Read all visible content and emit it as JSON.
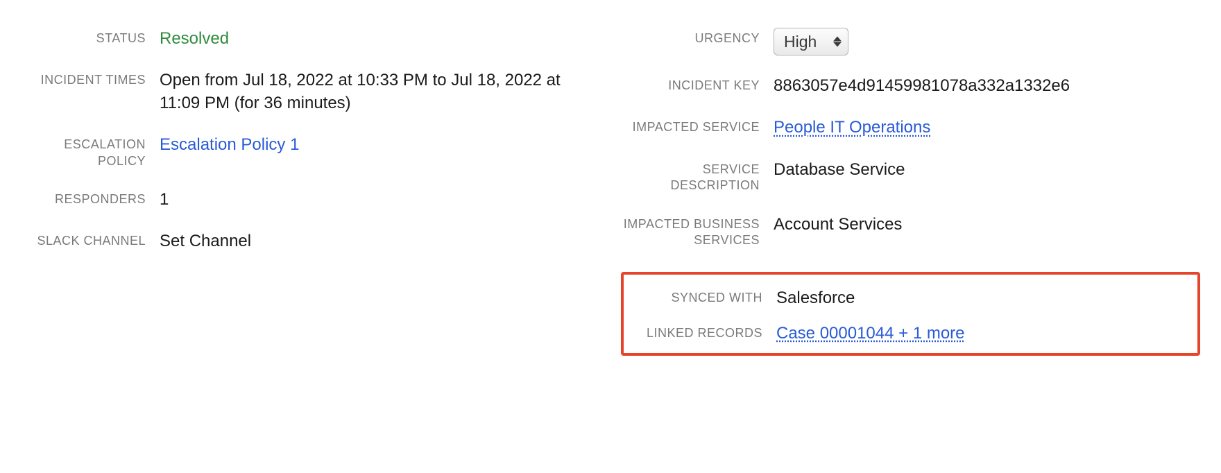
{
  "left": {
    "status": {
      "label": "STATUS",
      "value": "Resolved"
    },
    "incident_times": {
      "label": "INCIDENT TIMES",
      "value": "Open from Jul 18, 2022 at 10:33 PM to Jul 18, 2022 at 11:09 PM (for 36 minutes)"
    },
    "escalation_policy": {
      "label": "ESCALATION POLICY",
      "value": "Escalation Policy 1"
    },
    "responders": {
      "label": "RESPONDERS",
      "value": "1"
    },
    "slack_channel": {
      "label": "SLACK CHANNEL",
      "value": "Set Channel"
    }
  },
  "right": {
    "urgency": {
      "label": "URGENCY",
      "value": "High"
    },
    "incident_key": {
      "label": "INCIDENT KEY",
      "value": "8863057e4d91459981078a332a1332e6"
    },
    "impacted_service": {
      "label": "IMPACTED SERVICE",
      "value": "People IT Operations"
    },
    "service_description": {
      "label": "SERVICE DESCRIPTION",
      "value": "Database Service"
    },
    "impacted_business_services": {
      "label": "IMPACTED BUSINESS SERVICES",
      "value": "Account Services"
    },
    "synced_with": {
      "label": "SYNCED WITH",
      "value": "Salesforce"
    },
    "linked_records": {
      "label": "LINKED RECORDS",
      "value": "Case 00001044 + 1 more"
    }
  }
}
